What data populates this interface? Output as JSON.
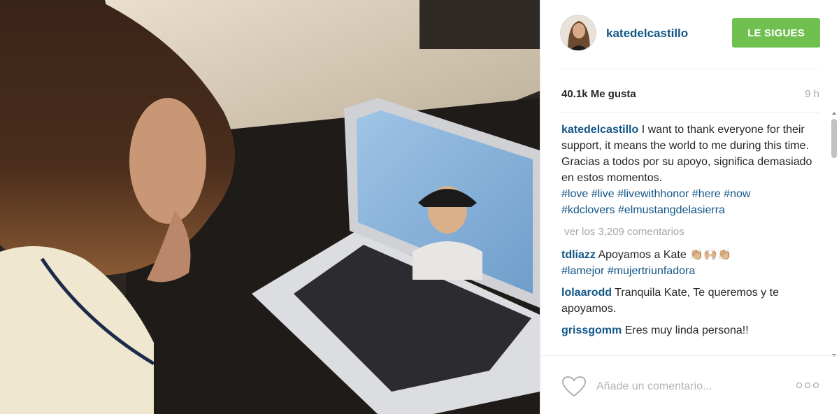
{
  "post": {
    "username": "katedelcastillo",
    "follow_label": "LE SIGUES",
    "likes": "40.1k Me gusta",
    "time": "9 h"
  },
  "caption": {
    "user": "katedelcastillo",
    "text_en": " I want to thank everyone for their support, it means the world to me during this time.",
    "text_es": "Gracias a todos por su apoyo, significa demasiado en estos momentos.",
    "hashtags": [
      "#love",
      "#live",
      "#livewithhonor",
      "#here",
      "#now",
      "#kdclovers",
      "#elmustangdelasierra"
    ]
  },
  "view_more": "ver los 3,209 comentarios",
  "comments": [
    {
      "user": "tdliazz",
      "text": " Apoyamos a Kate 👏🏼🙌🏼👏🏼",
      "tags": [
        "#lamejor",
        "#mujertriunfadora"
      ]
    },
    {
      "user": "lolaarodd",
      "text": " Tranquila Kate, Te queremos y te apoyamos."
    },
    {
      "user": "grissgomm",
      "text": " Eres muy linda persona!!"
    }
  ],
  "footer": {
    "comment_placeholder": "Añade un comentario..."
  },
  "colors": {
    "link": "#125688",
    "follow_bg": "#70c050",
    "muted": "#a5a7aa"
  },
  "icons": [
    "heart-icon",
    "more-options-icon",
    "avatar"
  ]
}
